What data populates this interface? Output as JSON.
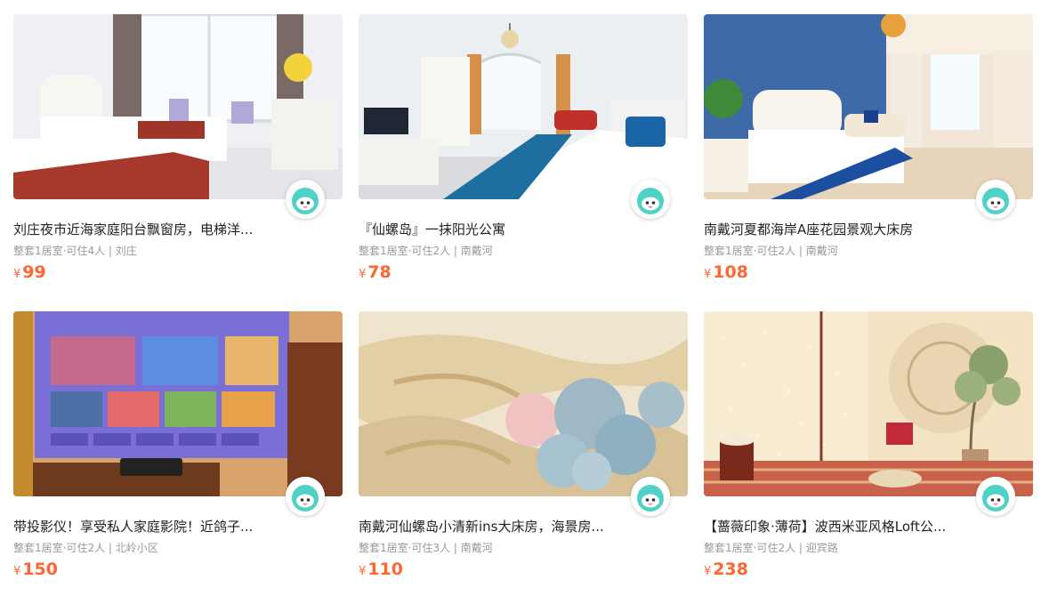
{
  "listings": [
    {
      "title": "刘庄夜市近海家庭阳台飘窗房，电梯洋...",
      "meta": "整套1居室·可住4人 | 刘庄",
      "currency": "¥",
      "price": "99",
      "image_icon": "bedroom-photo-icon"
    },
    {
      "title": "『仙螺岛』一抹阳光公寓",
      "meta": "整套1居室·可住2人 | 南戴河",
      "currency": "¥",
      "price": "78",
      "image_icon": "bedroom-photo-icon"
    },
    {
      "title": "南戴河夏都海岸A座花园景观大床房",
      "meta": "整套1居室·可住2人 | 南戴河",
      "currency": "¥",
      "price": "108",
      "image_icon": "bedroom-photo-icon"
    },
    {
      "title": "带投影仪！享受私人家庭影院！近鸽子...",
      "meta": "整套1居室·可住2人 | 北岭小区",
      "currency": "¥",
      "price": "150",
      "image_icon": "projector-photo-icon"
    },
    {
      "title": "南戴河仙螺岛小清新ins大床房，海景房...",
      "meta": "整套1居室·可住3人 | 南戴河",
      "currency": "¥",
      "price": "110",
      "image_icon": "bedding-flowers-photo-icon"
    },
    {
      "title": "【蔷薇印象·薄荷】波西米亚风格Loft公...",
      "meta": "整套1居室·可住2人 | 迎宾路",
      "currency": "¥",
      "price": "238",
      "image_icon": "bohemian-loft-photo-icon"
    }
  ],
  "colors": {
    "price": "#ff6633",
    "title": "#222222",
    "meta": "#999999",
    "avatar_body": "#4fd1c5"
  }
}
